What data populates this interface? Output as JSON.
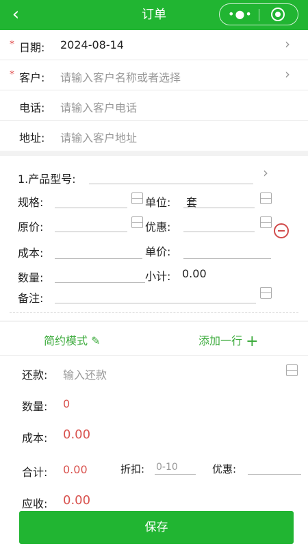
{
  "header": {
    "back_icon": "back-arrow-icon",
    "title": "订单",
    "more_icon": "more-dots-icon",
    "close_icon": "target-icon"
  },
  "customer": {
    "date_label": "日期:",
    "date_value": "2024-08-14",
    "customer_label": "客户:",
    "customer_placeholder": "请输入客户名称或者选择",
    "phone_label": "电话:",
    "phone_placeholder": "请输入客户电话",
    "address_label": "地址:",
    "address_placeholder": "请输入客户地址",
    "required_mark": "*"
  },
  "product": {
    "model_label": "1.产品型号:",
    "spec_label": "规格:",
    "unit_label": "单位:",
    "unit_value": "套",
    "price_label": "原价:",
    "discount_label": "优惠:",
    "cost_label": "成本:",
    "unit_price_label": "单价:",
    "qty_label": "数量:",
    "subtotal_label": "小计:",
    "subtotal_value": "0.00",
    "remark_label": "备注:"
  },
  "actions": {
    "simple_mode": "简约模式",
    "add_row": "添加一行",
    "add_icon": "plus-icon",
    "edit_icon": "edit-icon"
  },
  "summary": {
    "repay_label": "还款:",
    "repay_placeholder": "输入还款",
    "qty_label": "数量:",
    "qty_value": "0",
    "cost_label": "成本:",
    "cost_value": "0.00",
    "total_label": "合计:",
    "total_value": "0.00",
    "discount_rate_label": "折扣:",
    "discount_rate_placeholder": "0-10",
    "discount_label": "优惠:",
    "receivable_label": "应收:",
    "receivable_value": "0.00"
  },
  "footer": {
    "save_label": "保存"
  },
  "colors": {
    "brand_green": "#21b532",
    "accent_red": "#d9534f"
  }
}
